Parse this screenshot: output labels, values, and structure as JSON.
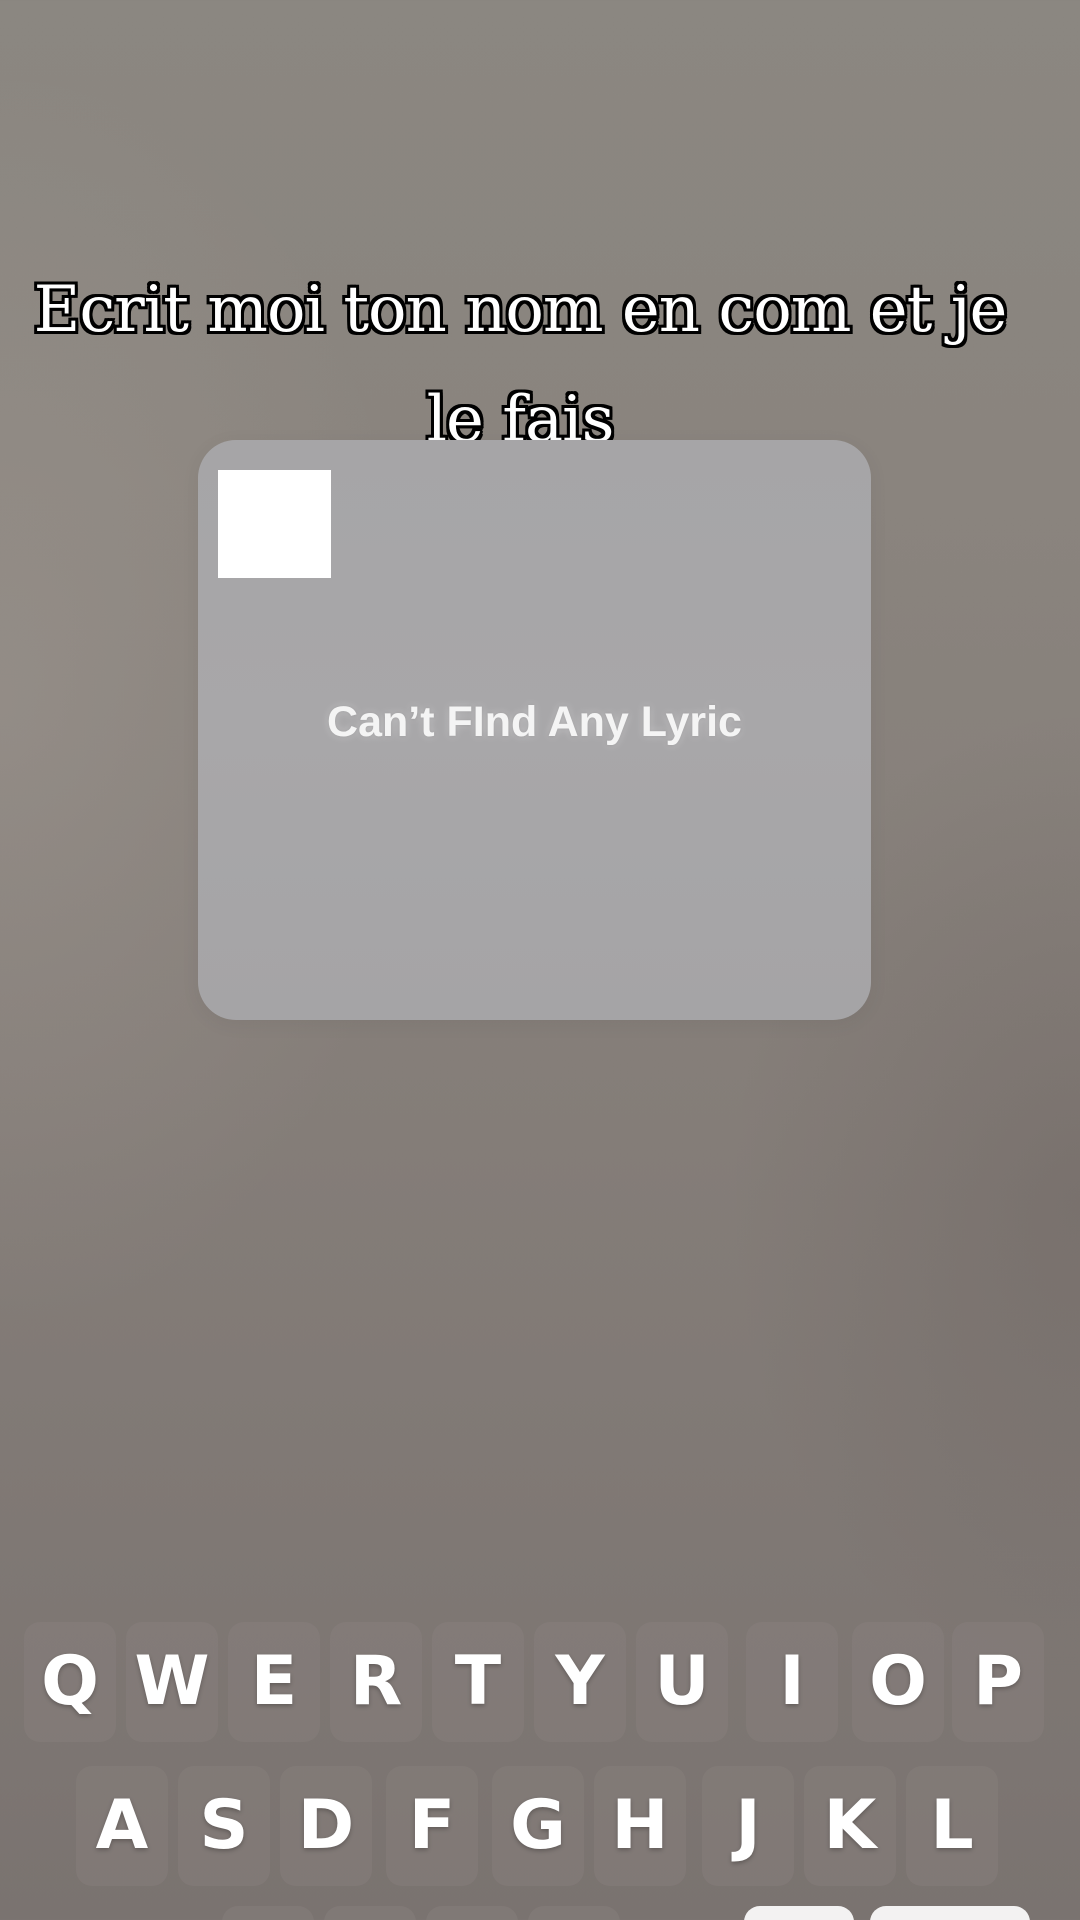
{
  "caption": {
    "line1": "Ecrit moi ton nom en com et je",
    "line2": "le fais"
  },
  "lyrics_card": {
    "message": "Can’t FInd Any Lyric"
  },
  "keyboard": {
    "row1": [
      "Q",
      "W",
      "E",
      "R",
      "T",
      "Y",
      "U",
      "I",
      "O",
      "P"
    ],
    "row2": [
      "A",
      "S",
      "D",
      "F",
      "G",
      "H",
      "J",
      "K",
      "L"
    ]
  }
}
